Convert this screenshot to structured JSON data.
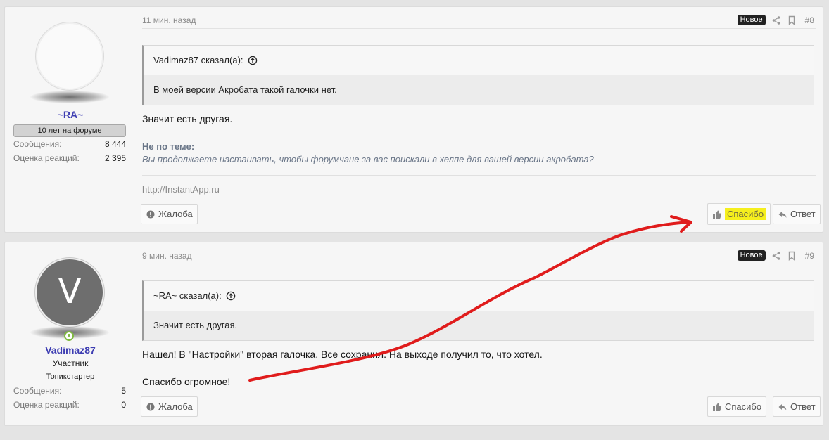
{
  "posts": [
    {
      "time": "11 мин. назад",
      "badge": "Новое",
      "number": "#8",
      "author": {
        "name": "~RA~",
        "banner": "10 лет на форуме",
        "stats": [
          {
            "label": "Сообщения:",
            "value": "8 444"
          },
          {
            "label": "Оценка реакций:",
            "value": "2 395"
          }
        ]
      },
      "quote": {
        "author": "Vadimaz87 сказал(а):",
        "text": "В моей версии Акробата такой галочки нет."
      },
      "message": [
        "Значит есть другая."
      ],
      "offtopic": {
        "title": "Не по теме:",
        "text": "Вы продолжаете настаивать, чтобы форумчане за вас поискали в хелпе для вашей версии акробата?"
      },
      "signature": "http://InstantApp.ru",
      "actions": {
        "report": "Жалоба",
        "like": "Спасибо",
        "reply": "Ответ"
      }
    },
    {
      "time": "9 мин. назад",
      "badge": "Новое",
      "number": "#9",
      "author": {
        "name": "Vadimaz87",
        "avatar_letter": "V",
        "title": "Участник",
        "subtitle": "Топикстартер",
        "stats": [
          {
            "label": "Сообщения:",
            "value": "5"
          },
          {
            "label": "Оценка реакций:",
            "value": "0"
          }
        ]
      },
      "quote": {
        "author": "~RA~ сказал(а):",
        "text": "Значит есть другая."
      },
      "message": [
        "Нашел! В \"Настройки\" вторая галочка. Все сохранил. На выходе получил то, что хотел.",
        "Спасибо огромное!"
      ],
      "actions": {
        "report": "Жалоба",
        "like": "Спасибо",
        "reply": "Ответ"
      }
    }
  ],
  "colors": {
    "username": "#3d3db2",
    "highlight": "#f5ef1e",
    "annotation": "#e01c1c"
  },
  "icons": [
    "share-icon",
    "bookmark-icon",
    "arrow-up-circle-icon",
    "report-icon",
    "thumbs-up-icon",
    "reply-icon"
  ]
}
